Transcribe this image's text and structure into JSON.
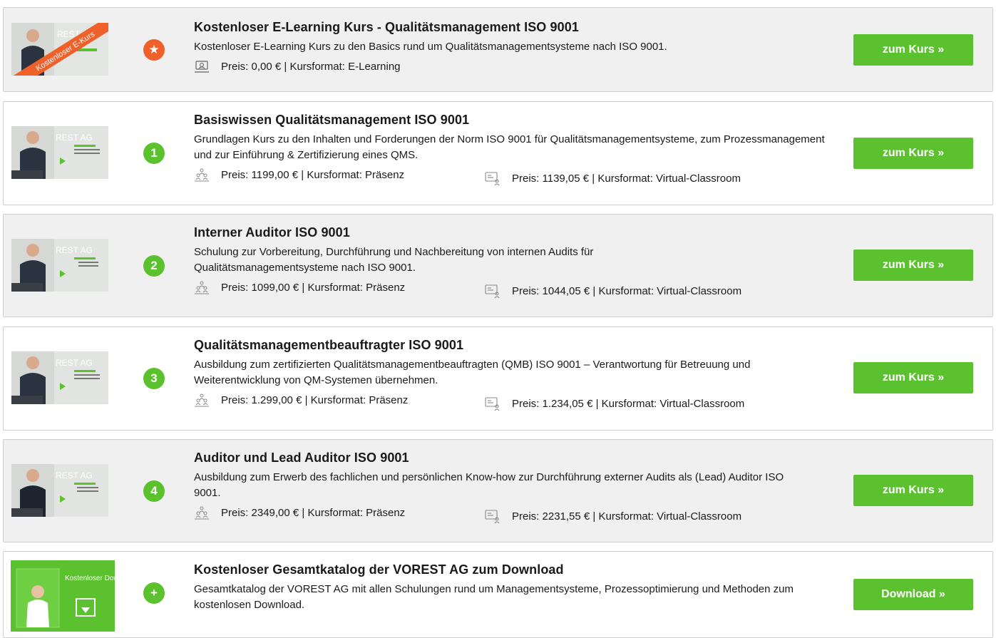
{
  "courses": [
    {
      "badge": "★",
      "thumb_overlay": "Kostenloser E-Kurs",
      "thumb_brand": "REST AG",
      "title": "Kostenloser E-Learning Kurs - Qualitätsmanagement ISO 9001",
      "description": "Kostenloser E-Learning Kurs zu den Basics rund um Qualitätsmanagementsysteme nach ISO 9001.",
      "price1": "Preis: 0,00 € | Kursformat: E-Learning",
      "price2": "",
      "button": "zum Kurs »"
    },
    {
      "badge": "1",
      "thumb_brand": "REST AG",
      "title": "Basiswissen Qualitätsmanagement ISO 9001",
      "description": "Grundlagen Kurs zu den Inhalten und Forderungen der Norm ISO 9001 für Qualitätsmanagementsysteme, zum Prozessmanagement und zur Einführung & Zertifizierung eines QMS.",
      "price1": "Preis: 1199,00 € | Kursformat: Präsenz",
      "price2": "Preis: 1139,05 € | Kursformat: Virtual-Classroom",
      "button": "zum Kurs »"
    },
    {
      "badge": "2",
      "thumb_brand": "REST AG",
      "title": "Interner Auditor ISO 9001",
      "description": "Schulung zur Vorbereitung, Durchführung und Nachbereitung von internen Audits für Qualitätsmanagementsysteme nach ISO 9001.",
      "price1": "Preis: 1099,00 € | Kursformat: Präsenz",
      "price2": "Preis: 1044,05 € | Kursformat: Virtual-Classroom",
      "button": "zum Kurs »"
    },
    {
      "badge": "3",
      "thumb_brand": "REST AG",
      "title": "Qualitätsmanagementbeauftragter ISO 9001",
      "description": "Ausbildung zum zertifizierten Qualitätsmanagementbeauftragten (QMB) ISO 9001 – Verantwortung für Betreuung und Weiterentwicklung von QM-Systemen übernehmen.",
      "price1": "Preis: 1.299,00 € | Kursformat: Präsenz",
      "price2": "Preis: 1.234,05 € | Kursformat: Virtual-Classroom",
      "button": "zum Kurs »"
    },
    {
      "badge": "4",
      "thumb_brand": "REST AG",
      "title": "Auditor und Lead Auditor ISO 9001",
      "description": "Ausbildung zum Erwerb des fachlichen und persönlichen Know-how zur Durchführung externer Audits als (Lead) Auditor ISO 9001.",
      "price1": "Preis: 2349,00 € | Kursformat: Präsenz",
      "price2": "Preis: 2231,55 € | Kursformat: Virtual-Classroom",
      "button": "zum Kurs »"
    },
    {
      "badge": "+",
      "thumb_overlay": "Kostenloser Download",
      "title": "Kostenloser Gesamtkatalog der VOREST AG zum Download",
      "description": "Gesamtkatalog der VOREST AG mit allen Schulungen rund um Managementsysteme, Prozessoptimierung und Methoden zum kostenlosen Download.",
      "price1": "",
      "price2": "",
      "button": "Download »"
    }
  ],
  "colors": {
    "accent_green": "#5cc12e",
    "accent_orange": "#f0602a",
    "card_grey": "#f0f0f0",
    "border": "#cfcfcf"
  },
  "icons": {
    "elearning": "elearning-icon",
    "presence": "classroom-presence-icon",
    "virtual": "virtual-classroom-icon"
  }
}
